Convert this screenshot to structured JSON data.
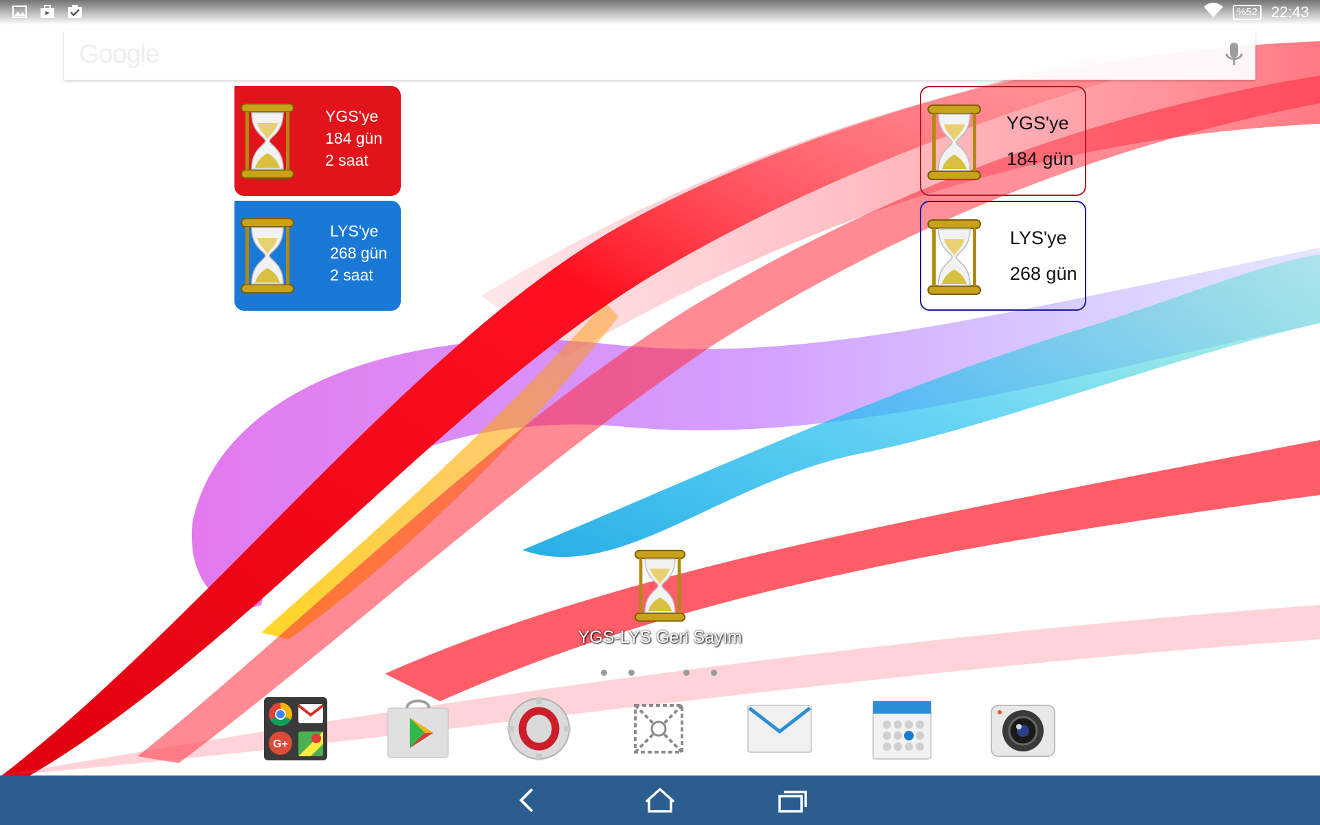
{
  "status_bar": {
    "notification_icons": [
      "image-icon",
      "shopping-bag-icon",
      "task-check-icon"
    ],
    "wifi_icon": "wifi-icon",
    "battery": "%52",
    "time": "22:43"
  },
  "search": {
    "placeholder_logo": "Google",
    "mic_icon": "microphone-icon"
  },
  "widgets": {
    "ygs_full": {
      "title": "YGS'ye",
      "days": "184 gün",
      "hours": "2 saat",
      "color": "#e0141a"
    },
    "lys_full": {
      "title": "LYS'ye",
      "days": "268 gün",
      "hours": "2 saat",
      "color": "#1a78d6"
    },
    "ygs_outline": {
      "title": "YGS'ye",
      "days": "184 gün",
      "border_color": "#b11a22"
    },
    "lys_outline": {
      "title": "LYS'ye",
      "days": "268 gün",
      "border_color": "#1a1aa0"
    }
  },
  "home_app": {
    "label": "YGS-LYS Geri Sayım",
    "icon": "hourglass-icon"
  },
  "page_indicator": {
    "pages": 4
  },
  "dock": [
    {
      "name": "google-folder",
      "icon": "google-apps-folder-icon"
    },
    {
      "name": "play-store",
      "icon": "play-store-icon"
    },
    {
      "name": "opera",
      "icon": "opera-icon"
    },
    {
      "name": "smart-connect",
      "icon": "connect-icon"
    },
    {
      "name": "email",
      "icon": "email-icon"
    },
    {
      "name": "calendar",
      "icon": "calendar-icon"
    },
    {
      "name": "camera",
      "icon": "camera-icon"
    }
  ],
  "nav": {
    "back": "back-icon",
    "home": "home-icon",
    "recents": "recents-icon",
    "bar_color": "#2c5d8f"
  }
}
